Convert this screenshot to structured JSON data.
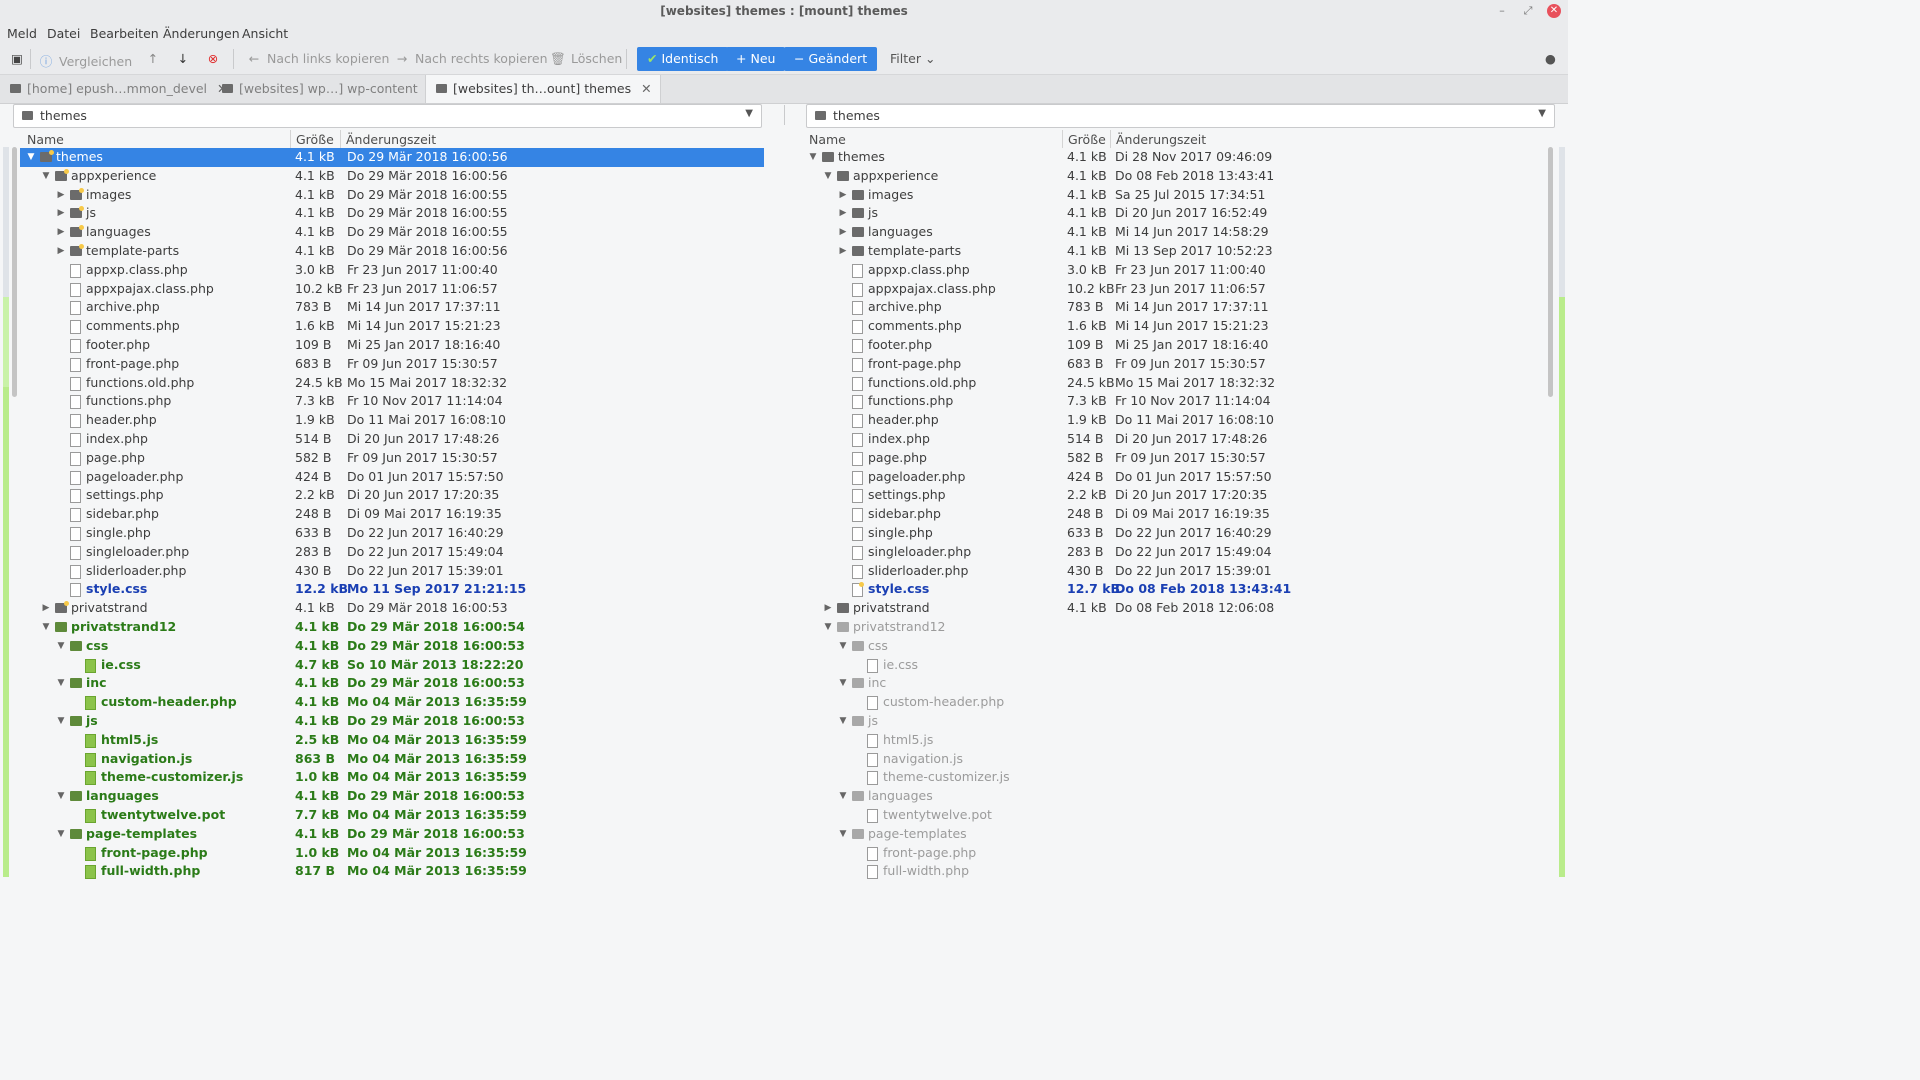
{
  "window": {
    "title": "[websites] themes : [mount] themes"
  },
  "menu": [
    "Meld",
    "Datei",
    "Bearbeiten",
    "Änderungen",
    "Ansicht"
  ],
  "toolbar": {
    "compare": "Vergleichen",
    "copy_left": "Nach links kopieren",
    "copy_right": "Nach rechts kopieren",
    "delete": "Löschen",
    "filter_identical": "Identisch",
    "filter_new": "Neu",
    "filter_changed": "Geändert",
    "filter": "Filter"
  },
  "tabs": [
    {
      "label": "[home] epush…mmon_devel"
    },
    {
      "label": "[websites] wp…] wp-content"
    },
    {
      "label": "[websites] th…ount] themes"
    }
  ],
  "left_path": "themes",
  "right_path": "themes",
  "columns": {
    "name": "Name",
    "size": "Größe",
    "mtime": "Änderungszeit"
  },
  "left_rows": [
    {
      "depth": 0,
      "kind": "dir",
      "expand": "open",
      "name": "themes",
      "size": "4.1 kB",
      "time": "Do 29 Mär 2018 16:00:56",
      "state": "normal",
      "sel": true,
      "star": true
    },
    {
      "depth": 1,
      "kind": "dir",
      "expand": "open",
      "name": "appxperience",
      "size": "4.1 kB",
      "time": "Do 29 Mär 2018 16:00:56",
      "state": "normal",
      "star": true
    },
    {
      "depth": 2,
      "kind": "dir",
      "expand": "closed",
      "name": "images",
      "size": "4.1 kB",
      "time": "Do 29 Mär 2018 16:00:55",
      "state": "normal",
      "star": true
    },
    {
      "depth": 2,
      "kind": "dir",
      "expand": "closed",
      "name": "js",
      "size": "4.1 kB",
      "time": "Do 29 Mär 2018 16:00:55",
      "state": "normal",
      "star": true
    },
    {
      "depth": 2,
      "kind": "dir",
      "expand": "closed",
      "name": "languages",
      "size": "4.1 kB",
      "time": "Do 29 Mär 2018 16:00:55",
      "state": "normal",
      "star": true
    },
    {
      "depth": 2,
      "kind": "dir",
      "expand": "closed",
      "name": "template-parts",
      "size": "4.1 kB",
      "time": "Do 29 Mär 2018 16:00:56",
      "state": "normal",
      "star": true
    },
    {
      "depth": 2,
      "kind": "file",
      "name": "appxp.class.php",
      "size": "3.0 kB",
      "time": "Fr 23 Jun 2017 11:00:40",
      "state": "normal"
    },
    {
      "depth": 2,
      "kind": "file",
      "name": "appxpajax.class.php",
      "size": "10.2 kB",
      "time": "Fr 23 Jun 2017 11:06:57",
      "state": "normal"
    },
    {
      "depth": 2,
      "kind": "file",
      "name": "archive.php",
      "size": "783 B",
      "time": "Mi 14 Jun 2017 17:37:11",
      "state": "normal"
    },
    {
      "depth": 2,
      "kind": "file",
      "name": "comments.php",
      "size": "1.6 kB",
      "time": "Mi 14 Jun 2017 15:21:23",
      "state": "normal"
    },
    {
      "depth": 2,
      "kind": "file",
      "name": "footer.php",
      "size": "109 B",
      "time": "Mi 25 Jan 2017 18:16:40",
      "state": "normal"
    },
    {
      "depth": 2,
      "kind": "file",
      "name": "front-page.php",
      "size": "683 B",
      "time": "Fr 09 Jun 2017 15:30:57",
      "state": "normal"
    },
    {
      "depth": 2,
      "kind": "file",
      "name": "functions.old.php",
      "size": "24.5 kB",
      "time": "Mo 15 Mai 2017 18:32:32",
      "state": "normal"
    },
    {
      "depth": 2,
      "kind": "file",
      "name": "functions.php",
      "size": "7.3 kB",
      "time": "Fr 10 Nov 2017 11:14:04",
      "state": "normal"
    },
    {
      "depth": 2,
      "kind": "file",
      "name": "header.php",
      "size": "1.9 kB",
      "time": "Do 11 Mai 2017 16:08:10",
      "state": "normal"
    },
    {
      "depth": 2,
      "kind": "file",
      "name": "index.php",
      "size": "514 B",
      "time": "Di 20 Jun 2017 17:48:26",
      "state": "normal"
    },
    {
      "depth": 2,
      "kind": "file",
      "name": "page.php",
      "size": "582 B",
      "time": "Fr 09 Jun 2017 15:30:57",
      "state": "normal"
    },
    {
      "depth": 2,
      "kind": "file",
      "name": "pageloader.php",
      "size": "424 B",
      "time": "Do 01 Jun 2017 15:57:50",
      "state": "normal"
    },
    {
      "depth": 2,
      "kind": "file",
      "name": "settings.php",
      "size": "2.2 kB",
      "time": "Di 20 Jun 2017 17:20:35",
      "state": "normal"
    },
    {
      "depth": 2,
      "kind": "file",
      "name": "sidebar.php",
      "size": "248 B",
      "time": "Di 09 Mai 2017 16:19:35",
      "state": "normal"
    },
    {
      "depth": 2,
      "kind": "file",
      "name": "single.php",
      "size": "633 B",
      "time": "Do 22 Jun 2017 16:40:29",
      "state": "normal"
    },
    {
      "depth": 2,
      "kind": "file",
      "name": "singleloader.php",
      "size": "283 B",
      "time": "Do 22 Jun 2017 15:49:04",
      "state": "normal"
    },
    {
      "depth": 2,
      "kind": "file",
      "name": "sliderloader.php",
      "size": "430 B",
      "time": "Do 22 Jun 2017 15:39:01",
      "state": "normal"
    },
    {
      "depth": 2,
      "kind": "file",
      "name": "style.css",
      "size": "12.2 kB",
      "time": "Mo 11 Sep 2017 21:21:15",
      "state": "modified"
    },
    {
      "depth": 1,
      "kind": "dir",
      "expand": "closed",
      "name": "privatstrand",
      "size": "4.1 kB",
      "time": "Do 29 Mär 2018 16:00:53",
      "state": "normal",
      "star": true
    },
    {
      "depth": 1,
      "kind": "dir",
      "expand": "open",
      "name": "privatstrand12",
      "size": "4.1 kB",
      "time": "Do 29 Mär 2018 16:00:54",
      "state": "new"
    },
    {
      "depth": 2,
      "kind": "dir",
      "expand": "open",
      "name": "css",
      "size": "4.1 kB",
      "time": "Do 29 Mär 2018 16:00:53",
      "state": "new"
    },
    {
      "depth": 3,
      "kind": "file",
      "name": "ie.css",
      "size": "4.7 kB",
      "time": "So 10 Mär 2013 18:22:20",
      "state": "new"
    },
    {
      "depth": 2,
      "kind": "dir",
      "expand": "open",
      "name": "inc",
      "size": "4.1 kB",
      "time": "Do 29 Mär 2018 16:00:53",
      "state": "new"
    },
    {
      "depth": 3,
      "kind": "file",
      "name": "custom-header.php",
      "size": "4.1 kB",
      "time": "Mo 04 Mär 2013 16:35:59",
      "state": "new"
    },
    {
      "depth": 2,
      "kind": "dir",
      "expand": "open",
      "name": "js",
      "size": "4.1 kB",
      "time": "Do 29 Mär 2018 16:00:53",
      "state": "new"
    },
    {
      "depth": 3,
      "kind": "file",
      "name": "html5.js",
      "size": "2.5 kB",
      "time": "Mo 04 Mär 2013 16:35:59",
      "state": "new"
    },
    {
      "depth": 3,
      "kind": "file",
      "name": "navigation.js",
      "size": "863 B",
      "time": "Mo 04 Mär 2013 16:35:59",
      "state": "new"
    },
    {
      "depth": 3,
      "kind": "file",
      "name": "theme-customizer.js",
      "size": "1.0 kB",
      "time": "Mo 04 Mär 2013 16:35:59",
      "state": "new"
    },
    {
      "depth": 2,
      "kind": "dir",
      "expand": "open",
      "name": "languages",
      "size": "4.1 kB",
      "time": "Do 29 Mär 2018 16:00:53",
      "state": "new"
    },
    {
      "depth": 3,
      "kind": "file",
      "name": "twentytwelve.pot",
      "size": "7.7 kB",
      "time": "Mo 04 Mär 2013 16:35:59",
      "state": "new"
    },
    {
      "depth": 2,
      "kind": "dir",
      "expand": "open",
      "name": "page-templates",
      "size": "4.1 kB",
      "time": "Do 29 Mär 2018 16:00:53",
      "state": "new"
    },
    {
      "depth": 3,
      "kind": "file",
      "name": "front-page.php",
      "size": "1.0 kB",
      "time": "Mo 04 Mär 2013 16:35:59",
      "state": "new"
    },
    {
      "depth": 3,
      "kind": "file",
      "name": "full-width.php",
      "size": "817 B",
      "time": "Mo 04 Mär 2013 16:35:59",
      "state": "new"
    }
  ],
  "right_rows": [
    {
      "depth": 0,
      "kind": "dir",
      "expand": "open",
      "name": "themes",
      "size": "4.1 kB",
      "time": "Di 28 Nov 2017 09:46:09",
      "state": "normal"
    },
    {
      "depth": 1,
      "kind": "dir",
      "expand": "open",
      "name": "appxperience",
      "size": "4.1 kB",
      "time": "Do 08 Feb 2018 13:43:41",
      "state": "normal"
    },
    {
      "depth": 2,
      "kind": "dir",
      "expand": "closed",
      "name": "images",
      "size": "4.1 kB",
      "time": "Sa 25 Jul 2015 17:34:51",
      "state": "normal"
    },
    {
      "depth": 2,
      "kind": "dir",
      "expand": "closed",
      "name": "js",
      "size": "4.1 kB",
      "time": "Di 20 Jun 2017 16:52:49",
      "state": "normal"
    },
    {
      "depth": 2,
      "kind": "dir",
      "expand": "closed",
      "name": "languages",
      "size": "4.1 kB",
      "time": "Mi 14 Jun 2017 14:58:29",
      "state": "normal"
    },
    {
      "depth": 2,
      "kind": "dir",
      "expand": "closed",
      "name": "template-parts",
      "size": "4.1 kB",
      "time": "Mi 13 Sep 2017 10:52:23",
      "state": "normal"
    },
    {
      "depth": 2,
      "kind": "file",
      "name": "appxp.class.php",
      "size": "3.0 kB",
      "time": "Fr 23 Jun 2017 11:00:40",
      "state": "normal"
    },
    {
      "depth": 2,
      "kind": "file",
      "name": "appxpajax.class.php",
      "size": "10.2 kB",
      "time": "Fr 23 Jun 2017 11:06:57",
      "state": "normal"
    },
    {
      "depth": 2,
      "kind": "file",
      "name": "archive.php",
      "size": "783 B",
      "time": "Mi 14 Jun 2017 17:37:11",
      "state": "normal"
    },
    {
      "depth": 2,
      "kind": "file",
      "name": "comments.php",
      "size": "1.6 kB",
      "time": "Mi 14 Jun 2017 15:21:23",
      "state": "normal"
    },
    {
      "depth": 2,
      "kind": "file",
      "name": "footer.php",
      "size": "109 B",
      "time": "Mi 25 Jan 2017 18:16:40",
      "state": "normal"
    },
    {
      "depth": 2,
      "kind": "file",
      "name": "front-page.php",
      "size": "683 B",
      "time": "Fr 09 Jun 2017 15:30:57",
      "state": "normal"
    },
    {
      "depth": 2,
      "kind": "file",
      "name": "functions.old.php",
      "size": "24.5 kB",
      "time": "Mo 15 Mai 2017 18:32:32",
      "state": "normal"
    },
    {
      "depth": 2,
      "kind": "file",
      "name": "functions.php",
      "size": "7.3 kB",
      "time": "Fr 10 Nov 2017 11:14:04",
      "state": "normal"
    },
    {
      "depth": 2,
      "kind": "file",
      "name": "header.php",
      "size": "1.9 kB",
      "time": "Do 11 Mai 2017 16:08:10",
      "state": "normal"
    },
    {
      "depth": 2,
      "kind": "file",
      "name": "index.php",
      "size": "514 B",
      "time": "Di 20 Jun 2017 17:48:26",
      "state": "normal"
    },
    {
      "depth": 2,
      "kind": "file",
      "name": "page.php",
      "size": "582 B",
      "time": "Fr 09 Jun 2017 15:30:57",
      "state": "normal"
    },
    {
      "depth": 2,
      "kind": "file",
      "name": "pageloader.php",
      "size": "424 B",
      "time": "Do 01 Jun 2017 15:57:50",
      "state": "normal"
    },
    {
      "depth": 2,
      "kind": "file",
      "name": "settings.php",
      "size": "2.2 kB",
      "time": "Di 20 Jun 2017 17:20:35",
      "state": "normal"
    },
    {
      "depth": 2,
      "kind": "file",
      "name": "sidebar.php",
      "size": "248 B",
      "time": "Di 09 Mai 2017 16:19:35",
      "state": "normal"
    },
    {
      "depth": 2,
      "kind": "file",
      "name": "single.php",
      "size": "633 B",
      "time": "Do 22 Jun 2017 16:40:29",
      "state": "normal"
    },
    {
      "depth": 2,
      "kind": "file",
      "name": "singleloader.php",
      "size": "283 B",
      "time": "Do 22 Jun 2017 15:49:04",
      "state": "normal"
    },
    {
      "depth": 2,
      "kind": "file",
      "name": "sliderloader.php",
      "size": "430 B",
      "time": "Do 22 Jun 2017 15:39:01",
      "state": "normal"
    },
    {
      "depth": 2,
      "kind": "file",
      "name": "style.css",
      "size": "12.7 kB",
      "time": "Do 08 Feb 2018 13:43:41",
      "state": "modified",
      "star": true
    },
    {
      "depth": 1,
      "kind": "dir",
      "expand": "closed",
      "name": "privatstrand",
      "size": "4.1 kB",
      "time": "Do 08 Feb 2018 12:06:08",
      "state": "normal"
    },
    {
      "depth": 1,
      "kind": "dir",
      "expand": "open",
      "name": "privatstrand12",
      "size": "",
      "time": "",
      "state": "missing"
    },
    {
      "depth": 2,
      "kind": "dir",
      "expand": "open",
      "name": "css",
      "size": "",
      "time": "",
      "state": "missing"
    },
    {
      "depth": 3,
      "kind": "file",
      "name": "ie.css",
      "size": "",
      "time": "",
      "state": "missing"
    },
    {
      "depth": 2,
      "kind": "dir",
      "expand": "open",
      "name": "inc",
      "size": "",
      "time": "",
      "state": "missing"
    },
    {
      "depth": 3,
      "kind": "file",
      "name": "custom-header.php",
      "size": "",
      "time": "",
      "state": "missing"
    },
    {
      "depth": 2,
      "kind": "dir",
      "expand": "open",
      "name": "js",
      "size": "",
      "time": "",
      "state": "missing"
    },
    {
      "depth": 3,
      "kind": "file",
      "name": "html5.js",
      "size": "",
      "time": "",
      "state": "missing"
    },
    {
      "depth": 3,
      "kind": "file",
      "name": "navigation.js",
      "size": "",
      "time": "",
      "state": "missing"
    },
    {
      "depth": 3,
      "kind": "file",
      "name": "theme-customizer.js",
      "size": "",
      "time": "",
      "state": "missing"
    },
    {
      "depth": 2,
      "kind": "dir",
      "expand": "open",
      "name": "languages",
      "size": "",
      "time": "",
      "state": "missing"
    },
    {
      "depth": 3,
      "kind": "file",
      "name": "twentytwelve.pot",
      "size": "",
      "time": "",
      "state": "missing"
    },
    {
      "depth": 2,
      "kind": "dir",
      "expand": "open",
      "name": "page-templates",
      "size": "",
      "time": "",
      "state": "missing"
    },
    {
      "depth": 3,
      "kind": "file",
      "name": "front-page.php",
      "size": "",
      "time": "",
      "state": "missing"
    },
    {
      "depth": 3,
      "kind": "file",
      "name": "full-width.php",
      "size": "",
      "time": "",
      "state": "missing"
    }
  ],
  "colors": {
    "selection": "#3584e4",
    "identical": "#4a9c2a",
    "new": "#3584e4",
    "changed": "#3584e4",
    "close": "#e8505b"
  },
  "icons": [
    "new-document-icon",
    "info-icon",
    "arrow-up-icon",
    "arrow-down-icon",
    "stop-icon",
    "arrow-left-icon",
    "arrow-right-icon",
    "trash-icon",
    "check-icon",
    "plus-icon",
    "minus-icon",
    "chevron-down-icon",
    "folder-icon",
    "file-icon",
    "close-icon"
  ]
}
